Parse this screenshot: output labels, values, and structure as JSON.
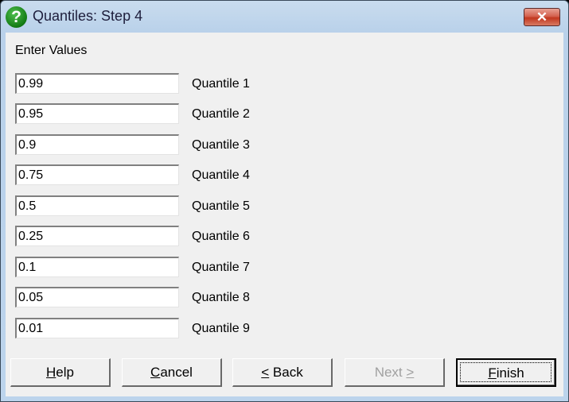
{
  "window": {
    "title": "Quantiles: Step 4",
    "icon": "question-icon",
    "close_icon": "close-icon"
  },
  "heading": "Enter Values",
  "quantiles": [
    {
      "value": "0.99",
      "label": "Quantile 1"
    },
    {
      "value": "0.95",
      "label": "Quantile 2"
    },
    {
      "value": "0.9",
      "label": "Quantile 3"
    },
    {
      "value": "0.75",
      "label": "Quantile 4"
    },
    {
      "value": "0.5",
      "label": "Quantile 5"
    },
    {
      "value": "0.25",
      "label": "Quantile 6"
    },
    {
      "value": "0.1",
      "label": "Quantile 7"
    },
    {
      "value": "0.05",
      "label": "Quantile 8"
    },
    {
      "value": "0.01",
      "label": "Quantile 9"
    }
  ],
  "buttons": {
    "help": {
      "mnemonic": "H",
      "rest": "elp"
    },
    "cancel": {
      "mnemonic": "C",
      "rest": "ancel"
    },
    "back": {
      "mnemonic": "<",
      "rest": " Back"
    },
    "next": {
      "pre": "Next ",
      "mnemonic": ">"
    },
    "finish": {
      "mnemonic": "F",
      "rest": "inish"
    }
  }
}
